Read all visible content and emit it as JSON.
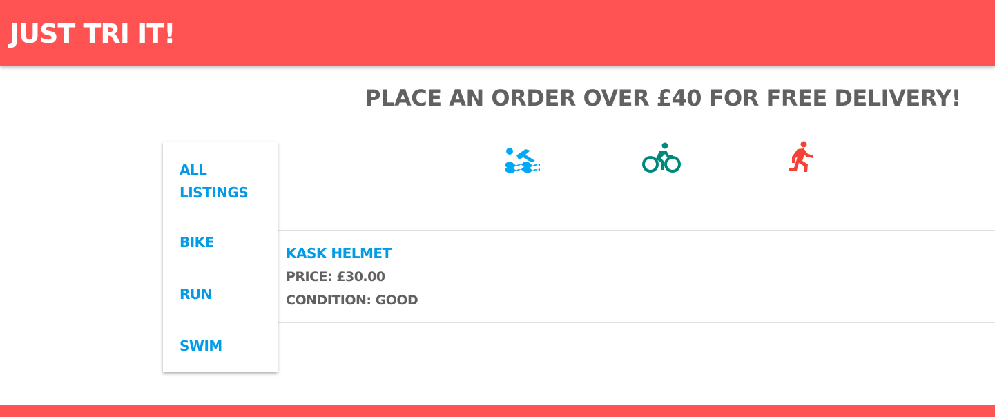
{
  "header": {
    "brand": "Just Tri it!"
  },
  "promo": {
    "text": "Place an order over £40 for free delivery!"
  },
  "sports": [
    {
      "icon": "swimming-icon",
      "color": "#03a9f4"
    },
    {
      "icon": "cycling-icon",
      "color": "#00897b"
    },
    {
      "icon": "running-icon",
      "color": "#f44336"
    }
  ],
  "sidebar": {
    "items": [
      {
        "label_line1": "All",
        "label_line2": "listings"
      },
      {
        "label": "Bike"
      },
      {
        "label": "Run"
      },
      {
        "label": "Swim"
      }
    ]
  },
  "listings": [
    {
      "title": "Kask helmet",
      "price": "Price: £30.00",
      "condition": "Condition: Good"
    }
  ],
  "colors": {
    "accent": "#ff5252",
    "link": "#039be5",
    "text": "#616161",
    "divider": "#e0e0e0"
  }
}
